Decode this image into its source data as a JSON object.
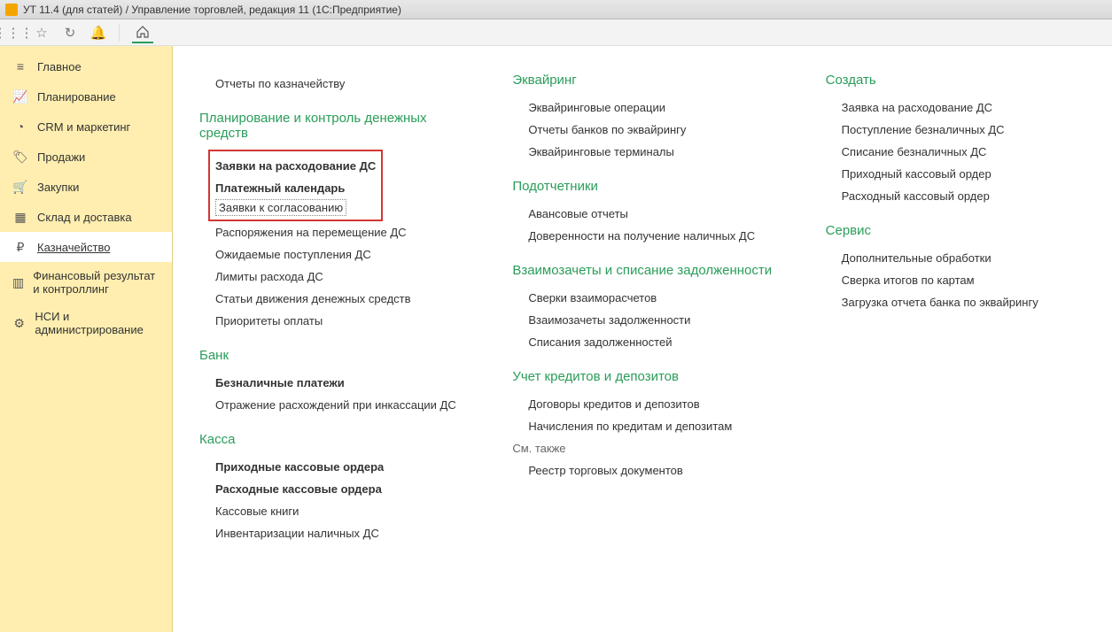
{
  "titlebar": {
    "text": "УТ 11.4 (для статей) / Управление торговлей, редакция 11  (1С:Предприятие)"
  },
  "sidebar": {
    "items": [
      {
        "label": "Главное",
        "icon": "menu"
      },
      {
        "label": "Планирование",
        "icon": "plan"
      },
      {
        "label": "CRM и маркетинг",
        "icon": "pie"
      },
      {
        "label": "Продажи",
        "icon": "tag"
      },
      {
        "label": "Закупки",
        "icon": "cart"
      },
      {
        "label": "Склад и доставка",
        "icon": "boxes"
      },
      {
        "label": "Казначейство",
        "icon": "ruble",
        "active": true
      },
      {
        "label": "Финансовый результат и контроллинг",
        "icon": "bars"
      },
      {
        "label": "НСИ и администрирование",
        "icon": "gear"
      }
    ]
  },
  "col1": {
    "top_link": "Отчеты по казначейству",
    "sec1": {
      "title": "Планирование и контроль денежных средств",
      "highlighted": [
        "Заявки на расходование ДС",
        "Платежный календарь",
        "Заявки к согласованию"
      ],
      "items": [
        "Распоряжения на перемещение ДС",
        "Ожидаемые поступления ДС",
        "Лимиты расхода ДС",
        "Статьи движения денежных средств",
        "Приоритеты оплаты"
      ]
    },
    "sec2": {
      "title": "Банк",
      "items": [
        {
          "label": "Безналичные платежи",
          "bold": true
        },
        {
          "label": "Отражение расхождений при инкассации ДС",
          "bold": false
        }
      ]
    },
    "sec3": {
      "title": "Касса",
      "items": [
        {
          "label": "Приходные кассовые ордера",
          "bold": true
        },
        {
          "label": "Расходные кассовые ордера",
          "bold": true
        },
        {
          "label": "Кассовые книги",
          "bold": false
        },
        {
          "label": "Инвентаризации наличных ДС",
          "bold": false
        }
      ]
    }
  },
  "col2": {
    "sec1": {
      "title": "Эквайринг",
      "items": [
        "Эквайринговые операции",
        "Отчеты банков по эквайрингу",
        "Эквайринговые терминалы"
      ]
    },
    "sec2": {
      "title": "Подотчетники",
      "items": [
        "Авансовые отчеты",
        "Доверенности на получение наличных ДС"
      ]
    },
    "sec3": {
      "title": "Взаимозачеты и списание задолженности",
      "items": [
        "Сверки взаиморасчетов",
        "Взаимозачеты задолженности",
        "Списания задолженностей"
      ]
    },
    "sec4": {
      "title": "Учет кредитов и депозитов",
      "items": [
        "Договоры кредитов и депозитов",
        "Начисления по кредитам и депозитам"
      ]
    },
    "see_also": {
      "label": "См. также",
      "items": [
        "Реестр торговых документов"
      ]
    }
  },
  "col3": {
    "sec1": {
      "title": "Создать",
      "items": [
        "Заявка на расходование ДС",
        "Поступление безналичных ДС",
        "Списание безналичных ДС",
        "Приходный кассовый ордер",
        "Расходный кассовый ордер"
      ]
    },
    "sec2": {
      "title": "Сервис",
      "items": [
        "Дополнительные обработки",
        "Сверка итогов по картам",
        "Загрузка отчета банка по эквайрингу"
      ]
    }
  }
}
